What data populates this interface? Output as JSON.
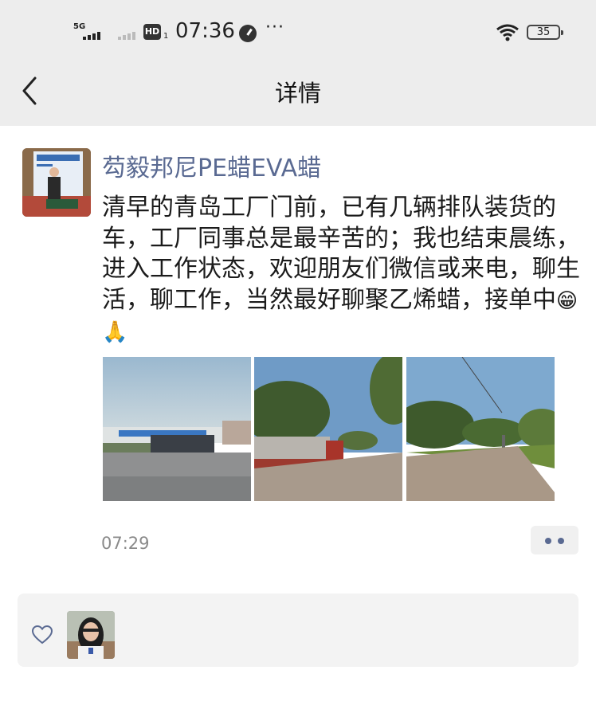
{
  "status_bar": {
    "network": "5G",
    "hd_label": "HD",
    "hd_sub": "1",
    "time": "07:36",
    "more": "···",
    "battery": "35"
  },
  "nav": {
    "title": "详情",
    "back_icon": "chevron-left-icon"
  },
  "post": {
    "author": "芶毅邦尼PE蜡EVA蜡",
    "text": "清早的青岛工厂门前，已有几辆排队装货的车，工厂同事总是最辛苦的；我也结束晨练，进入工作状态，欢迎朋友们微信或来电，聊生活，聊工作，当然最好聊聚乙烯蜡，接单中",
    "emojis": "😁🙏",
    "time": "07:29",
    "photos": [
      "factory-gate-photo",
      "trucks-queue-photo",
      "road-trees-photo"
    ]
  },
  "likes": {
    "icon": "heart-icon"
  },
  "colors": {
    "header_bg": "#ededed",
    "author_name": "#5a6a92",
    "timestamp": "#8a8a8a",
    "likes_bg": "#f3f3f3"
  }
}
